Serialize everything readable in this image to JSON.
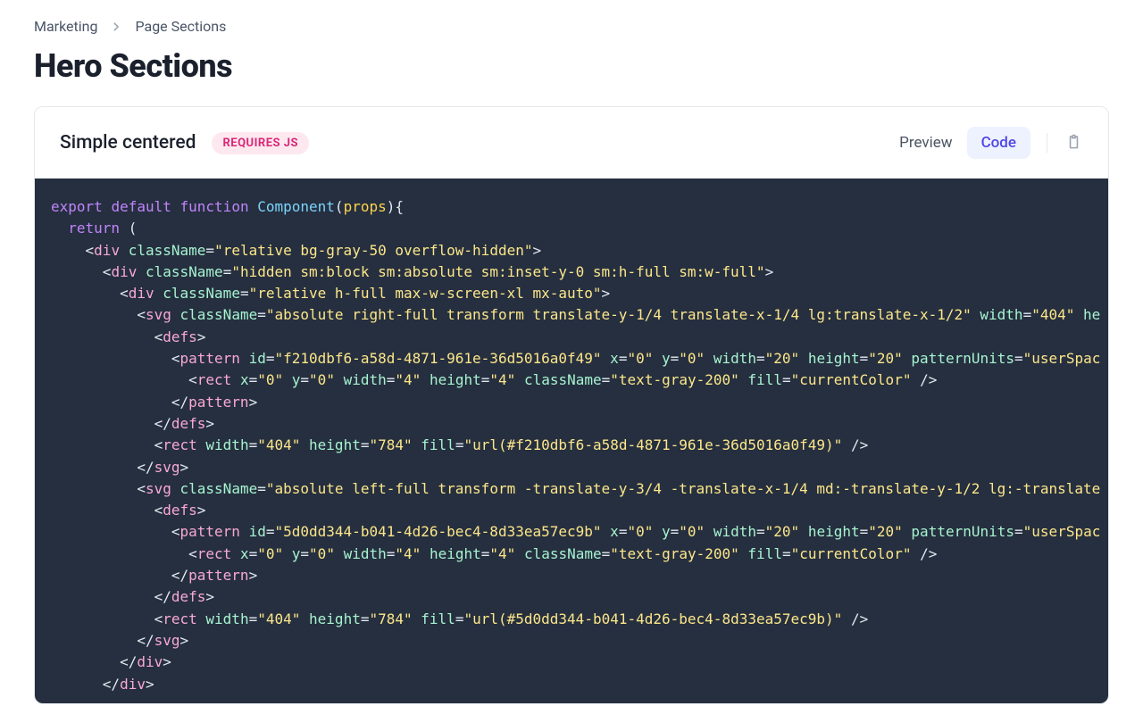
{
  "breadcrumb": {
    "items": [
      "Marketing",
      "Page Sections"
    ]
  },
  "page_title": "Hero Sections",
  "card": {
    "title": "Simple centered",
    "badge": "REQUIRES JS",
    "tabs": {
      "preview": "Preview",
      "code": "Code",
      "active": "Code"
    }
  },
  "code": {
    "l1a": "export",
    "l1b": "default",
    "l1c": "function",
    "l1d": "Component",
    "l1e": "props",
    "l2a": "return",
    "l3tag": "div",
    "l3attr": "className",
    "l3val": "\"relative bg-gray-50 overflow-hidden\"",
    "l4tag": "div",
    "l4attr": "className",
    "l4val": "\"hidden sm:block sm:absolute sm:inset-y-0 sm:h-full sm:w-full\"",
    "l5tag": "div",
    "l5attr": "className",
    "l5val": "\"relative h-full max-w-screen-xl mx-auto\"",
    "l6tag": "svg",
    "l6a1": "className",
    "l6v1": "\"absolute right-full transform translate-y-1/4 translate-x-1/4 lg:translate-x-1/2\"",
    "l6a2": "width",
    "l6v2": "\"404\"",
    "l6a3": "he",
    "l7tag": "defs",
    "l8tag": "pattern",
    "l8a1": "id",
    "l8v1": "\"f210dbf6-a58d-4871-961e-36d5016a0f49\"",
    "l8a2": "x",
    "l8v2": "\"0\"",
    "l8a3": "y",
    "l8v3": "\"0\"",
    "l8a4": "width",
    "l8v4": "\"20\"",
    "l8a5": "height",
    "l8v5": "\"20\"",
    "l8a6": "patternUnits",
    "l8v6": "\"userSpac",
    "l9tag": "rect",
    "l9a1": "x",
    "l9v1": "\"0\"",
    "l9a2": "y",
    "l9v2": "\"0\"",
    "l9a3": "width",
    "l9v3": "\"4\"",
    "l9a4": "height",
    "l9v4": "\"4\"",
    "l9a5": "className",
    "l9v5": "\"text-gray-200\"",
    "l9a6": "fill",
    "l9v6": "\"currentColor\"",
    "l10tag": "pattern",
    "l11tag": "defs",
    "l12tag": "rect",
    "l12a1": "width",
    "l12v1": "\"404\"",
    "l12a2": "height",
    "l12v2": "\"784\"",
    "l12a3": "fill",
    "l12v3": "\"url(#f210dbf6-a58d-4871-961e-36d5016a0f49)\"",
    "l13tag": "svg",
    "l14tag": "svg",
    "l14a1": "className",
    "l14v1": "\"absolute left-full transform -translate-y-3/4 -translate-x-1/4 md:-translate-y-1/2 lg:-translate",
    "l15tag": "defs",
    "l16tag": "pattern",
    "l16a1": "id",
    "l16v1": "\"5d0dd344-b041-4d26-bec4-8d33ea57ec9b\"",
    "l16a2": "x",
    "l16v2": "\"0\"",
    "l16a3": "y",
    "l16v3": "\"0\"",
    "l16a4": "width",
    "l16v4": "\"20\"",
    "l16a5": "height",
    "l16v5": "\"20\"",
    "l16a6": "patternUnits",
    "l16v6": "\"userSpac",
    "l17tag": "rect",
    "l17a1": "x",
    "l17v1": "\"0\"",
    "l17a2": "y",
    "l17v2": "\"0\"",
    "l17a3": "width",
    "l17v3": "\"4\"",
    "l17a4": "height",
    "l17v4": "\"4\"",
    "l17a5": "className",
    "l17v5": "\"text-gray-200\"",
    "l17a6": "fill",
    "l17v6": "\"currentColor\"",
    "l18tag": "pattern",
    "l19tag": "defs",
    "l20tag": "rect",
    "l20a1": "width",
    "l20v1": "\"404\"",
    "l20a2": "height",
    "l20v2": "\"784\"",
    "l20a3": "fill",
    "l20v3": "\"url(#5d0dd344-b041-4d26-bec4-8d33ea57ec9b)\"",
    "l21tag": "svg",
    "l22tag": "div",
    "l23tag": "div"
  }
}
